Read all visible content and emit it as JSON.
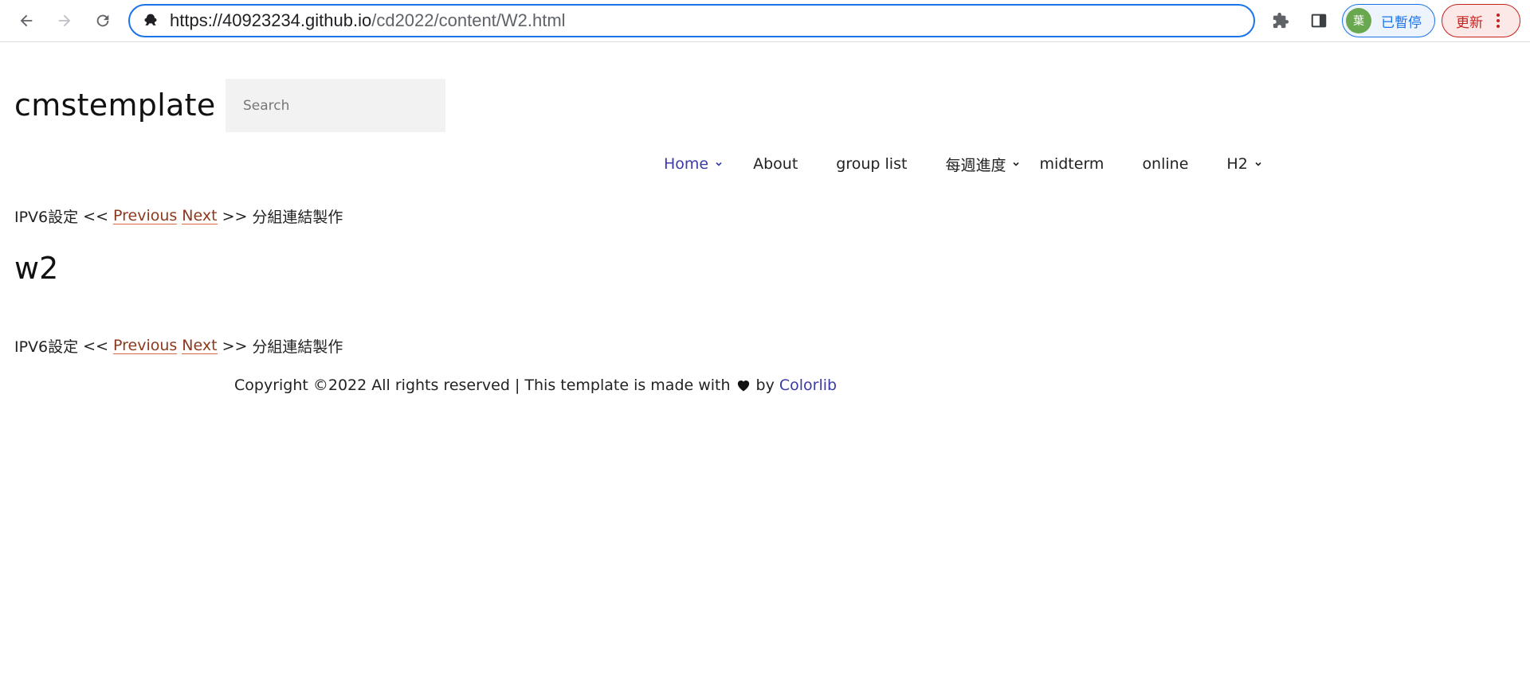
{
  "browser": {
    "url_host": "https://40923234.github.io",
    "url_path": "/cd2022/content/W2.html",
    "profile_avatar": "葉",
    "profile_label": "已暫停",
    "update_label": "更新",
    "icons": {
      "back": "back-arrow-icon",
      "forward": "forward-arrow-icon",
      "reload": "reload-icon",
      "site": "site-info-icon",
      "extensions": "puzzle-icon",
      "side_panel": "side-panel-icon",
      "menu": "more-vert-icon"
    }
  },
  "header": {
    "site_title": "cmstemplate",
    "search_placeholder": "Search"
  },
  "nav": {
    "items": [
      {
        "label": "Home",
        "has_dropdown": true,
        "active": true
      },
      {
        "label": "About",
        "has_dropdown": false
      },
      {
        "label": "group list",
        "has_dropdown": false
      },
      {
        "label": "每週進度",
        "has_dropdown": true
      },
      {
        "label": "midterm",
        "has_dropdown": false
      },
      {
        "label": "online",
        "has_dropdown": false
      },
      {
        "label": "H2",
        "has_dropdown": true
      }
    ]
  },
  "pager": {
    "prev_title": "IPV6設定",
    "prev_arrows": "<<",
    "previous_label": "Previous",
    "next_label": "Next",
    "next_arrows": ">>",
    "next_title": "分組連結製作"
  },
  "main": {
    "heading": "w2"
  },
  "footer": {
    "text": "Copyright ©2022 All rights reserved | This template is made with",
    "by": "by",
    "link": "Colorlib"
  },
  "colors": {
    "accent_blue": "#1a73e8",
    "nav_active": "#3b3ba8",
    "link_underline": "#d8674a",
    "update_red": "#c5221f"
  }
}
